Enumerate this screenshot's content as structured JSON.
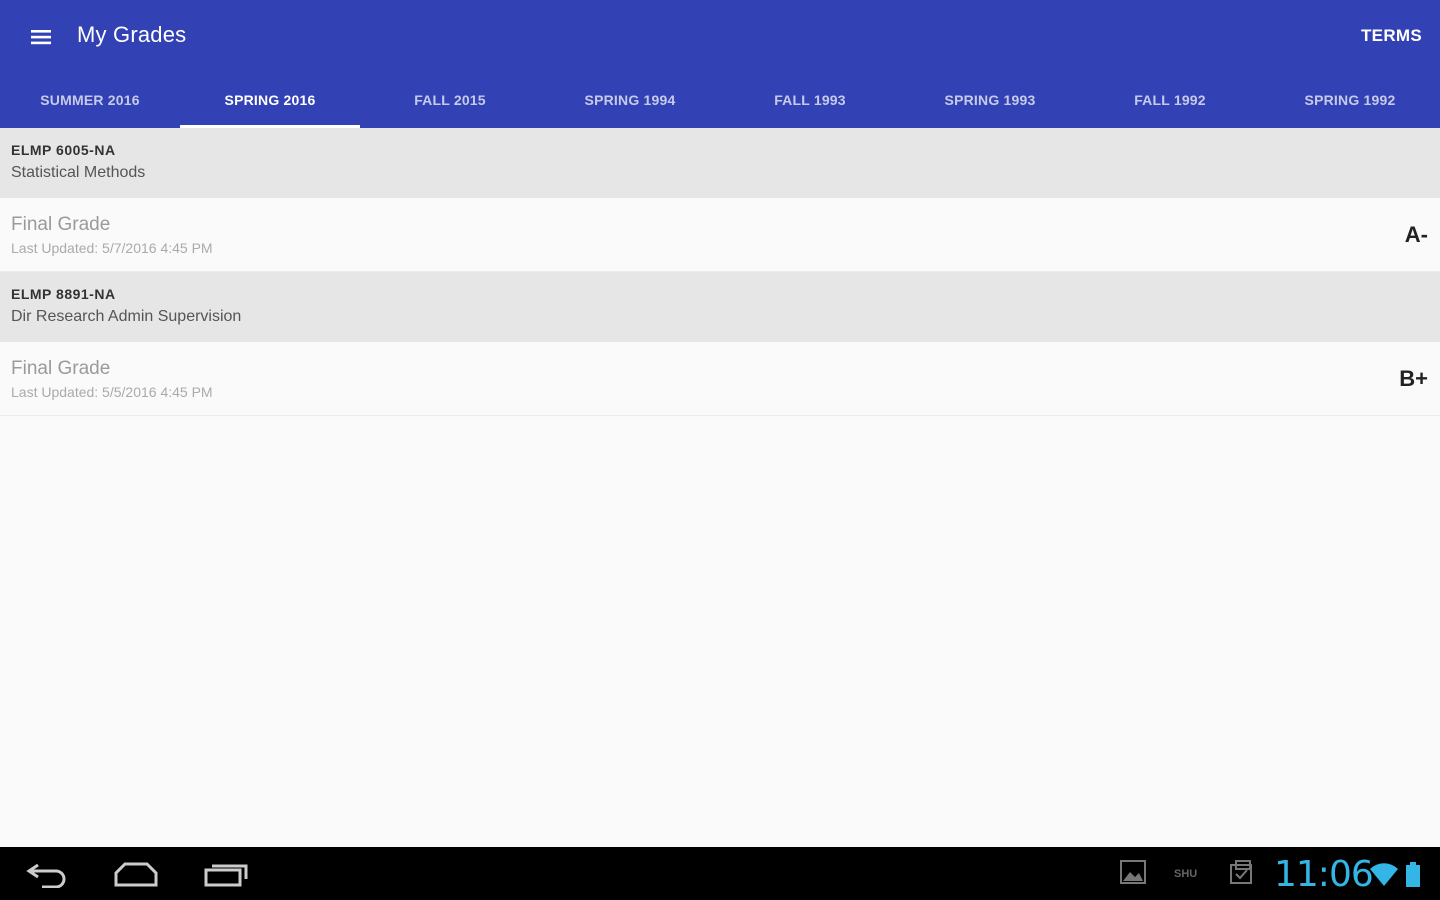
{
  "app": {
    "title": "My Grades",
    "terms_label": "TERMS",
    "accent": "#3241b3"
  },
  "tabs": [
    {
      "label": "SUMMER 2016",
      "active": false
    },
    {
      "label": "SPRING 2016",
      "active": true
    },
    {
      "label": "FALL 2015",
      "active": false
    },
    {
      "label": "SPRING 1994",
      "active": false
    },
    {
      "label": "FALL 1993",
      "active": false
    },
    {
      "label": "SPRING 1993",
      "active": false
    },
    {
      "label": "FALL 1992",
      "active": false
    },
    {
      "label": "SPRING 1992",
      "active": false
    }
  ],
  "courses": [
    {
      "code": "ELMP 6005-NA",
      "name": "Statistical Methods",
      "grade_label": "Final Grade",
      "updated": "Last Updated: 5/7/2016 4:45 PM",
      "grade": "A-"
    },
    {
      "code": "ELMP 8891-NA",
      "name": "Dir Research Admin Supervision",
      "grade_label": "Final Grade",
      "updated": "Last Updated: 5/5/2016 4:45 PM",
      "grade": "B+"
    }
  ],
  "system": {
    "clock": "11:06",
    "ime_label": "SHU",
    "clock_color": "#33b5e5",
    "icons": [
      "back-icon",
      "home-icon",
      "recent-apps-icon",
      "gallery-notification-icon",
      "keyboard-indicator",
      "clipboard-notification-icon",
      "wifi-icon",
      "battery-icon"
    ]
  }
}
